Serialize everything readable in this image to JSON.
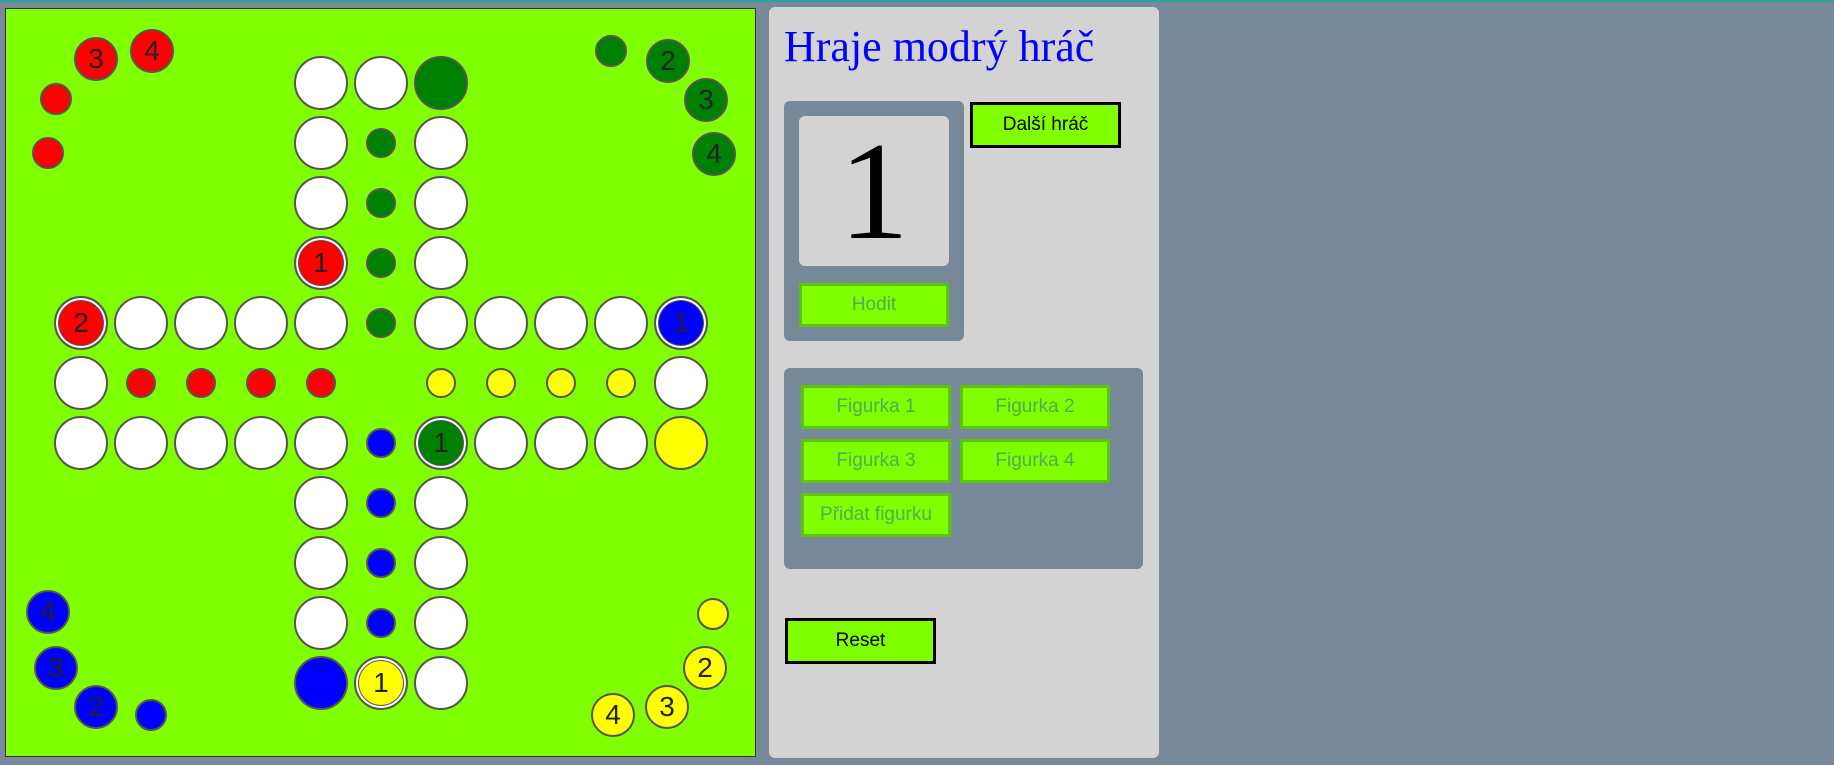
{
  "status": {
    "title": "Hraje modrý hráč"
  },
  "dice": {
    "value": "1",
    "roll_label": "Hodit"
  },
  "controls": {
    "next_player_label": "Další hráč",
    "piece_buttons": [
      "Figurka 1",
      "Figurka 2",
      "Figurka 3",
      "Figurka 4"
    ],
    "add_piece_label": "Přidat figurku",
    "reset_label": "Reset"
  },
  "colors": {
    "board": "#7fff00",
    "field": "#ffffff",
    "red": "#ff0000",
    "green": "#008000",
    "blue": "#0000ff",
    "yellow": "#ffff00",
    "title": "#0000ff",
    "panel": "#d3d3d3",
    "panel_box": "#778899",
    "button": "#7fff00"
  },
  "board": {
    "fields": [
      {
        "color": "white",
        "large": true
      },
      {
        "color": "white",
        "large": true
      },
      {
        "color": "green",
        "large": true
      },
      {
        "color": "white",
        "large": true
      },
      {
        "color": "green"
      },
      {
        "color": "white",
        "large": true
      },
      {
        "color": "white",
        "large": true
      },
      {
        "color": "green"
      },
      {
        "color": "white",
        "large": true
      },
      {
        "color": "red",
        "large": true,
        "label": "1",
        "ring": true
      },
      {
        "color": "green"
      },
      {
        "color": "white",
        "large": true
      },
      {
        "color": "red",
        "large": true,
        "label": "2",
        "ring": true
      },
      {
        "color": "white",
        "large": true
      },
      {
        "color": "white",
        "large": true
      },
      {
        "color": "white",
        "large": true
      },
      {
        "color": "white",
        "large": true
      },
      {
        "color": "green"
      },
      {
        "color": "white",
        "large": true
      },
      {
        "color": "white",
        "large": true
      },
      {
        "color": "white",
        "large": true
      },
      {
        "color": "white",
        "large": true
      },
      {
        "color": "blue",
        "large": true,
        "label": "1",
        "ring": true
      },
      {
        "color": "white",
        "large": true
      },
      {
        "color": "red"
      },
      {
        "color": "red"
      },
      {
        "color": "red"
      },
      {
        "color": "red"
      },
      {
        "color": "yellow"
      },
      {
        "color": "yellow"
      },
      {
        "color": "yellow"
      },
      {
        "color": "yellow"
      },
      {
        "color": "white",
        "large": true
      },
      {
        "color": "white",
        "large": true
      },
      {
        "color": "white",
        "large": true
      },
      {
        "color": "white",
        "large": true
      },
      {
        "color": "white",
        "large": true
      },
      {
        "color": "white",
        "large": true
      },
      {
        "color": "blue"
      },
      {
        "color": "green",
        "large": true,
        "label": "1",
        "ring": true
      },
      {
        "color": "white",
        "large": true
      },
      {
        "color": "white",
        "large": true
      },
      {
        "color": "white",
        "large": true
      },
      {
        "color": "yellow",
        "large": true
      },
      {
        "color": "white",
        "large": true
      },
      {
        "color": "blue"
      },
      {
        "color": "white",
        "large": true
      },
      {
        "color": "white",
        "large": true
      },
      {
        "color": "blue"
      },
      {
        "color": "white",
        "large": true
      },
      {
        "color": "white",
        "large": true
      },
      {
        "color": "blue"
      },
      {
        "color": "white",
        "large": true
      },
      {
        "color": "blue",
        "large": true
      },
      {
        "color": "yellow",
        "large": true,
        "label": "1",
        "ring": true
      },
      {
        "color": "white",
        "large": true
      }
    ],
    "home_pieces": [
      {
        "color": "red",
        "label": "3"
      },
      {
        "color": "red",
        "label": "4"
      },
      {
        "color": "red"
      },
      {
        "color": "red"
      },
      {
        "color": "green"
      },
      {
        "color": "green",
        "label": "2"
      },
      {
        "color": "green",
        "label": "3"
      },
      {
        "color": "green",
        "label": "4"
      },
      {
        "color": "blue",
        "label": "4"
      },
      {
        "color": "blue",
        "label": "3"
      },
      {
        "color": "blue",
        "label": "2"
      },
      {
        "color": "blue"
      },
      {
        "color": "yellow"
      },
      {
        "color": "yellow",
        "label": "2"
      },
      {
        "color": "yellow",
        "label": "3"
      },
      {
        "color": "yellow",
        "label": "4"
      }
    ]
  }
}
